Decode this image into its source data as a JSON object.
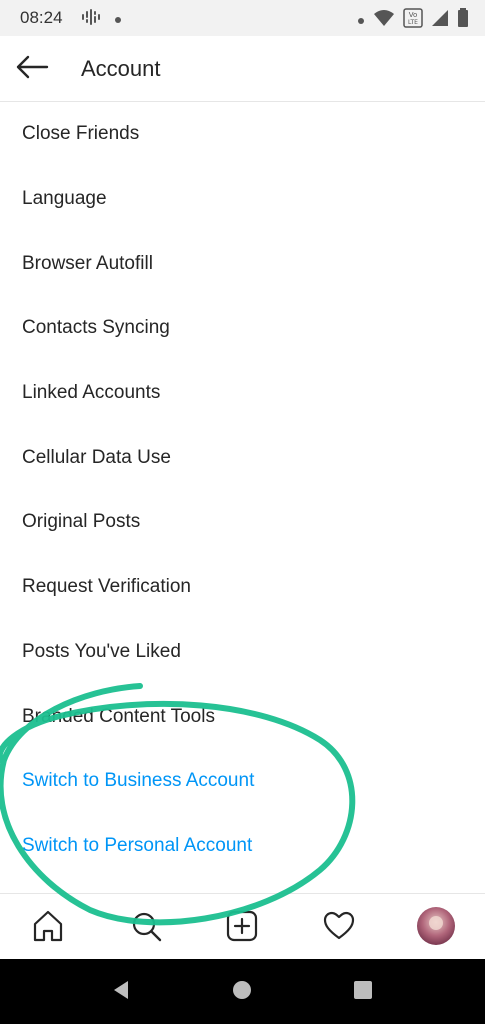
{
  "status_bar": {
    "time": "08:24",
    "icons": [
      "podcast-icon",
      "dot-icon",
      "dot-icon",
      "wifi-icon",
      "volte-icon",
      "signal-icon",
      "battery-icon"
    ],
    "volte_text": "Vo LTE"
  },
  "header": {
    "title": "Account",
    "back_icon": "arrow-left-icon"
  },
  "menu": {
    "items": [
      {
        "label": "Close Friends"
      },
      {
        "label": "Language"
      },
      {
        "label": "Browser Autofill"
      },
      {
        "label": "Contacts Syncing"
      },
      {
        "label": "Linked Accounts"
      },
      {
        "label": "Cellular Data Use"
      },
      {
        "label": "Original Posts"
      },
      {
        "label": "Request Verification"
      },
      {
        "label": "Posts You've Liked"
      },
      {
        "label": "Branded Content Tools"
      },
      {
        "label": "Switch to Business Account"
      },
      {
        "label": "Switch to Personal Account"
      }
    ]
  },
  "tab_bar": {
    "tabs": [
      "home-icon",
      "search-icon",
      "new-post-icon",
      "activity-heart-icon",
      "profile-avatar"
    ]
  },
  "nav_bar": {
    "buttons": [
      "back-triangle-icon",
      "home-circle-icon",
      "recents-square-icon"
    ]
  },
  "colors": {
    "link": "#0095f6",
    "annotation": "#1bbf8f",
    "text": "#262626"
  }
}
